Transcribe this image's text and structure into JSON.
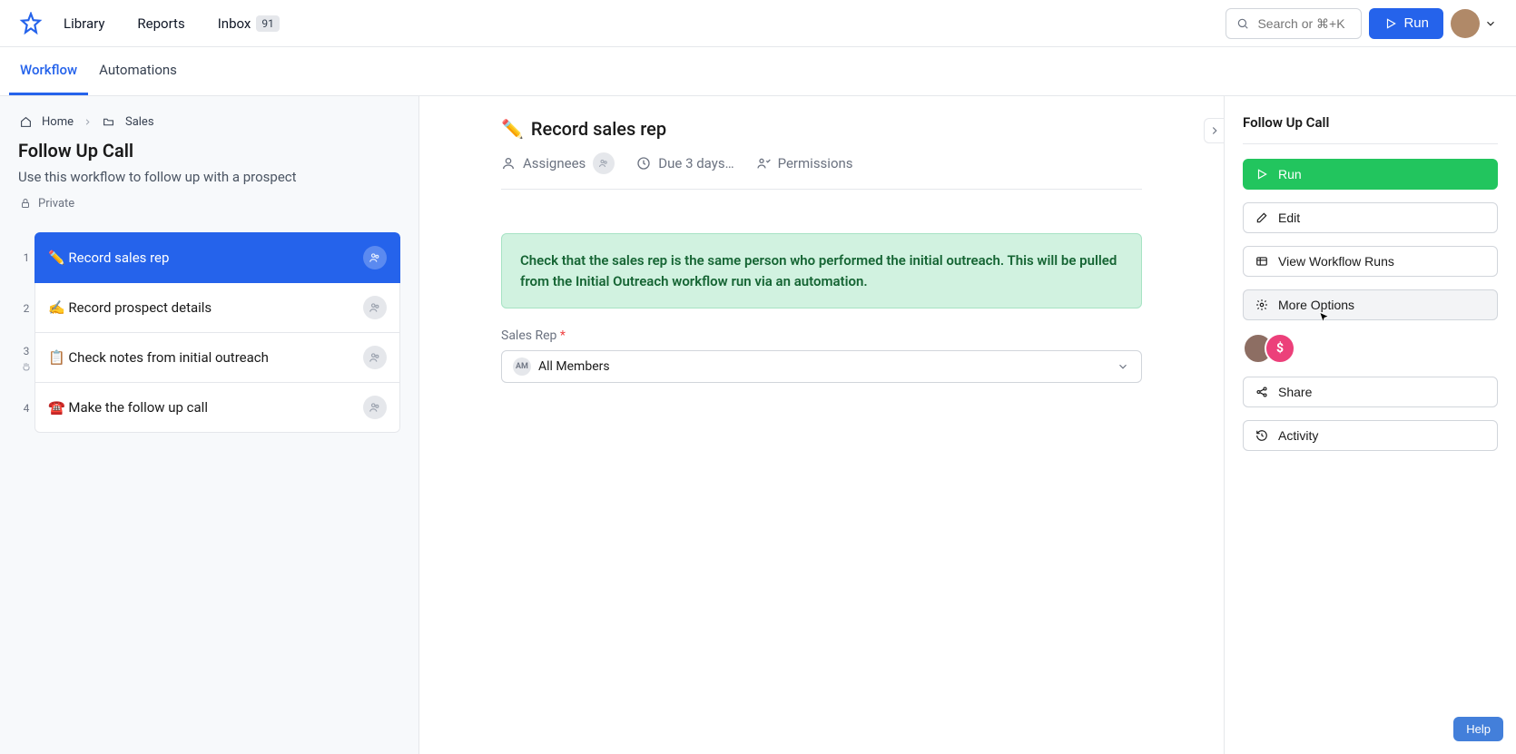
{
  "topnav": {
    "library": "Library",
    "reports": "Reports",
    "inbox": "Inbox",
    "inbox_count": "91",
    "search_placeholder": "Search or ⌘+K",
    "run": "Run"
  },
  "tabs": {
    "workflow": "Workflow",
    "automations": "Automations"
  },
  "breadcrumb": {
    "home": "Home",
    "folder": "Sales"
  },
  "workflow": {
    "title": "Follow Up Call",
    "description": "Use this workflow to follow up with a prospect",
    "privacy": "Private"
  },
  "steps": [
    {
      "num": "1",
      "emoji": "✏️",
      "label": "Record sales rep"
    },
    {
      "num": "2",
      "emoji": "✍️",
      "label": "Record prospect details"
    },
    {
      "num": "3",
      "emoji": "📋",
      "label": "Check notes from initial outreach"
    },
    {
      "num": "4",
      "emoji": "☎️",
      "label": "Make the follow up call"
    }
  ],
  "task": {
    "emoji": "✏️",
    "title": "Record sales rep",
    "assignees_label": "Assignees",
    "due_label": "Due 3 days…",
    "permissions_label": "Permissions",
    "callout": "Check that the sales rep is the same person who performed the initial outreach. This will be pulled from the Initial Outreach workflow run via an automation.",
    "field_label": "Sales Rep",
    "field_required": "*",
    "select_pill": "AM",
    "select_value": "All Members"
  },
  "sidepanel": {
    "title": "Follow Up Call",
    "run": "Run",
    "edit": "Edit",
    "view_runs": "View Workflow Runs",
    "more_options": "More Options",
    "share": "Share",
    "activity": "Activity",
    "avatar2_char": "$"
  },
  "help": "Help"
}
